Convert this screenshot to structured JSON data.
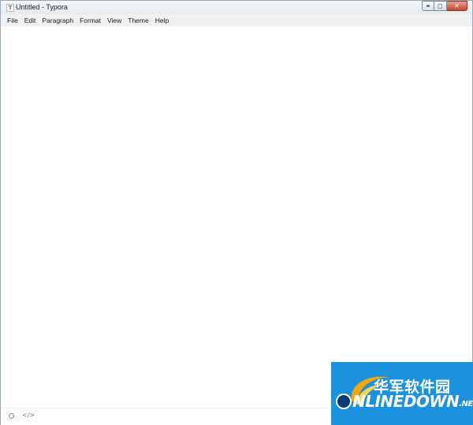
{
  "window": {
    "title": "Untitled - Typora",
    "app_icon_letter": "T",
    "controls": {
      "minimize": "▬",
      "maximize": "◻",
      "close": "✕"
    }
  },
  "menubar": {
    "items": [
      {
        "label": "File"
      },
      {
        "label": "Edit"
      },
      {
        "label": "Paragraph"
      },
      {
        "label": "Format"
      },
      {
        "label": "View"
      },
      {
        "label": "Theme"
      },
      {
        "label": "Help"
      }
    ]
  },
  "statusbar": {
    "left_icons": [
      "circle-outline-icon",
      "code-icon"
    ],
    "code_glyph": "</>"
  },
  "watermark": {
    "cn": "华军软件园",
    "en_first_letter": "O",
    "en_rest": "NLINEDOWN",
    "en_suffix": ".NET",
    "colors": {
      "background": "#1c92de",
      "swoosh": "#f6a800",
      "dark": "#0b3a78"
    }
  }
}
